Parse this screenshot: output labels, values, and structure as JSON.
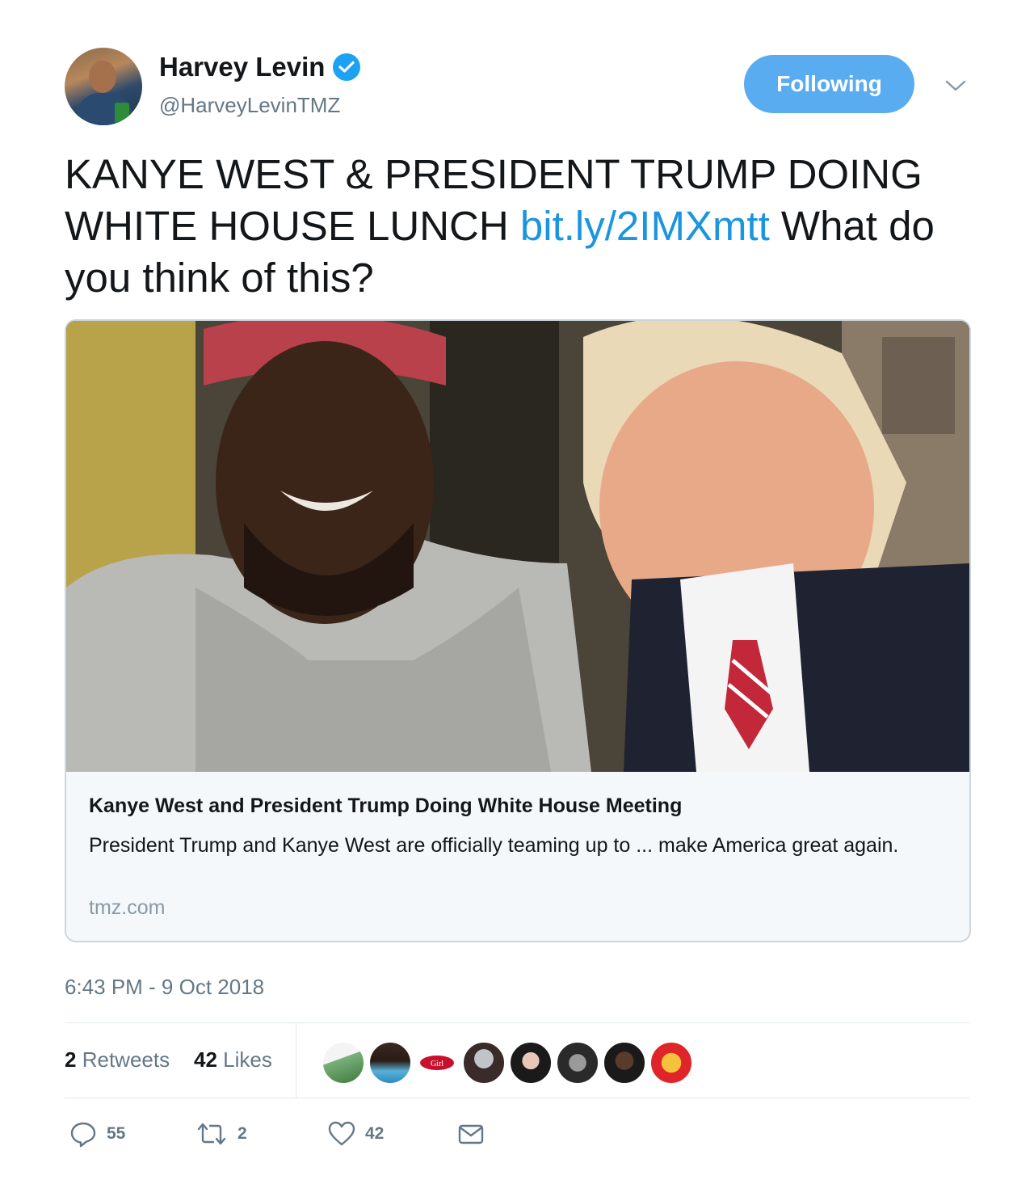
{
  "author": {
    "name": "Harvey Levin",
    "handle": "@HarveyLevinTMZ",
    "verified": true,
    "avatar_icon": "avatar-photo"
  },
  "follow_button": {
    "label": "Following",
    "color": "#5aacf0"
  },
  "tweet": {
    "text_before": "KANYE WEST & PRESIDENT TRUMP DOING WHITE HOUSE LUNCH ",
    "link": "bit.ly/2IMXmtt",
    "text_after": " What do you think of this?"
  },
  "card": {
    "title": "Kanye West and President Trump Doing White House Meeting",
    "description": "President Trump and Kanye West are officially teaming up to ... make America great again.",
    "domain": "tmz.com"
  },
  "timestamp": "6:43 PM - 9 Oct 2018",
  "stats": {
    "retweets_count": "2",
    "retweets_label": "Retweets",
    "likes_count": "42",
    "likes_label": "Likes",
    "liker_avatar_count": 8
  },
  "actions": {
    "reply_count": "55",
    "retweet_count": "2",
    "like_count": "42"
  },
  "colors": {
    "link": "#1b95e0",
    "verified": "#1da1f2",
    "secondary_text": "#657786"
  }
}
